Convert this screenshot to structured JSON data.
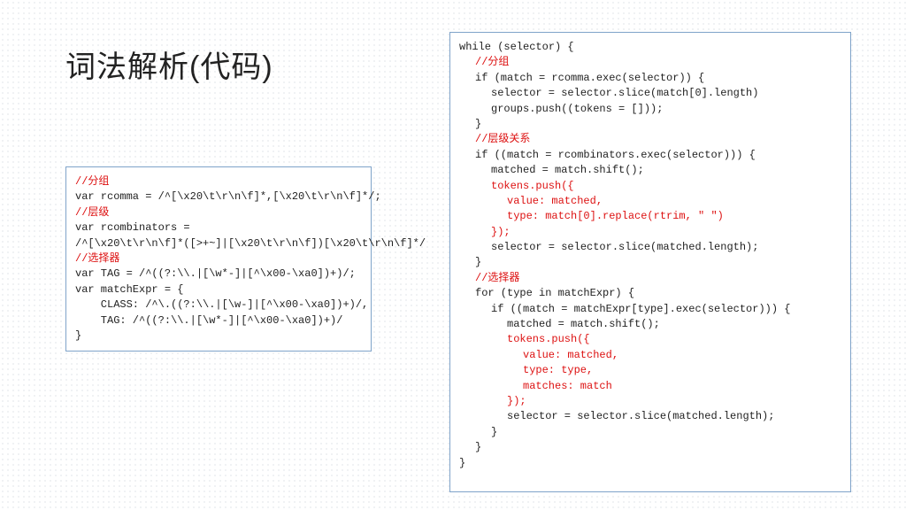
{
  "title": "词法解析(代码)",
  "left_box": {
    "l1_slash": "//",
    "l1_cmt": "分组",
    "l2": "var rcomma = /^[\\x20\\t\\r\\n\\f]*,[\\x20\\t\\r\\n\\f]*/;",
    "l3_slash": "//",
    "l3_cmt": "层级",
    "l4": "var rcombinators =",
    "l5": "/^[\\x20\\t\\r\\n\\f]*([>+~]|[\\x20\\t\\r\\n\\f])[\\x20\\t\\r\\n\\f]*/",
    "l6_slash": "//",
    "l6_cmt": "选择器",
    "l7": "var TAG = /^((?:\\\\.|[\\w*-]|[^\\x00-\\xa0])+)/;",
    "l8": "var matchExpr = {",
    "l9": "    CLASS: /^\\.((?:\\\\.|[\\w-]|[^\\x00-\\xa0])+)/,",
    "l10": "    TAG: /^((?:\\\\.|[\\w*-]|[^\\x00-\\xa0])+)/",
    "l11": "}"
  },
  "right_box": {
    "r1": "while (selector) {",
    "r2_slash": "//",
    "r2_cmt": "分组",
    "r3": "if (match = rcomma.exec(selector)) {",
    "r4": "selector = selector.slice(match[0].length)",
    "r5": "groups.push((tokens = []));",
    "r6": "}",
    "r7_slash": "//",
    "r7_cmt": "层级关系",
    "r8": "if ((match = rcombinators.exec(selector))) {",
    "r9": "matched = match.shift();",
    "r10": "tokens.push({",
    "r11": "value: matched,",
    "r12": "type: match[0].replace(rtrim, \" \")",
    "r13": "});",
    "r14": "selector = selector.slice(matched.length);",
    "r15": "}",
    "r16_slash": "//",
    "r16_cmt": "选择器",
    "r17": "for (type in matchExpr) {",
    "r18": "if ((match = matchExpr[type].exec(selector))) {",
    "r19": "matched = match.shift();",
    "r20": "tokens.push({",
    "r21": "value: matched,",
    "r22": "type: type,",
    "r23": "matches: match",
    "r24": "});",
    "r25": "selector = selector.slice(matched.length);",
    "r26": "}",
    "r27": "}",
    "r28": "}"
  }
}
